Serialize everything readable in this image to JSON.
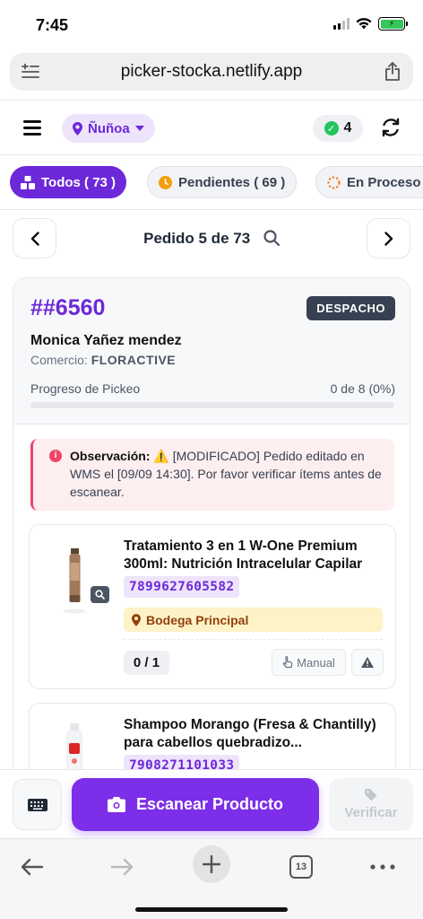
{
  "status": {
    "time": "7:45"
  },
  "browser": {
    "url": "picker-stocka.netlify.app",
    "tab_count": "13"
  },
  "header": {
    "location": "Ñuñoa",
    "done_count": "4"
  },
  "tabs": [
    {
      "label": "Todos ( 73 )"
    },
    {
      "label": "Pendientes ( 69 )"
    },
    {
      "label": "En Proceso"
    }
  ],
  "nav": {
    "title": "Pedido 5 de 73"
  },
  "order": {
    "id": "##6560",
    "type_badge": "DESPACHO",
    "customer": "Monica Yañez mendez",
    "commerce_label": "Comercio:",
    "commerce": "FLORACTIVE",
    "progress_label": "Progreso de Pickeo",
    "progress_text": "0 de 8 (0%)",
    "progress_fraction": 0,
    "observation_label": "Observación:",
    "observation_text": "[MODIFICADO] Pedido editado en WMS el [09/09 14:30]. Por favor verificar ítems antes de escanear."
  },
  "items": [
    {
      "name": "Tratamiento 3 en 1 W-One Premium 300ml: Nutrición Intracelular Capilar",
      "sku": "7899627605582",
      "location": "Bodega Principal",
      "qty": "0 / 1",
      "manual_label": "Manual"
    },
    {
      "name": "Shampoo Morango (Fresa & Chantilly) para cabellos quebradizo...",
      "sku": "7908271101033"
    }
  ],
  "actions": {
    "scan_label": "Escanear Producto",
    "verify_label": "Verificar"
  },
  "colors": {
    "accent": "#6d28d9",
    "scan": "#7c2ee8",
    "success": "#22c55e",
    "danger": "#ef4468",
    "warning_bg": "#fef3c7"
  }
}
